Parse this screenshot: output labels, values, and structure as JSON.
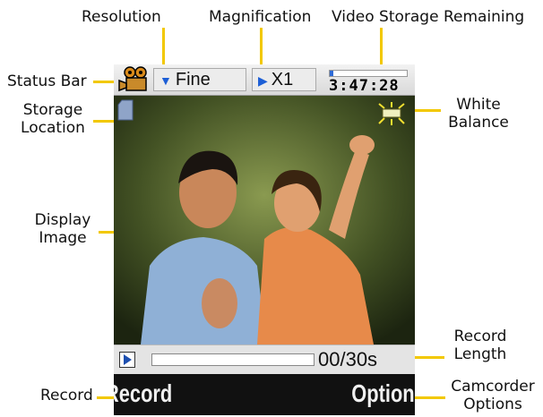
{
  "callouts": {
    "resolution": "Resolution",
    "magnification": "Magnification",
    "video_storage": "Video Storage Remaining",
    "status_bar": "Status Bar",
    "storage_location_1": "Storage",
    "storage_location_2": "Location",
    "white_balance_1": "White",
    "white_balance_2": "Balance",
    "display_image_1": "Display",
    "display_image_2": "Image",
    "record_length_1": "Record",
    "record_length_2": "Length",
    "record": "Record",
    "camcorder_options_1": "Camcorder",
    "camcorder_options_2": "Options"
  },
  "status_bar": {
    "resolution": "Fine",
    "magnification": "X1",
    "storage_remaining_time": "3:47:28",
    "storage_used_fraction": 0.05
  },
  "record_bar": {
    "length": "00/30s",
    "progress_fraction": 0.0
  },
  "softkeys": {
    "left": "Record",
    "right": "Options"
  },
  "colors": {
    "leader": "#f2c800",
    "accent_blue": "#1d5fd6",
    "softkey_bg": "#111111"
  },
  "icons": {
    "camcorder": "camcorder-icon",
    "storage": "memory-card-icon",
    "white_balance": "white-balance-icon",
    "play": "play-icon"
  }
}
